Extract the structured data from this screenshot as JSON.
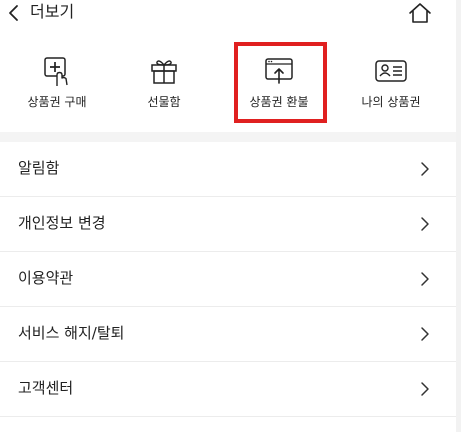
{
  "header": {
    "title": "더보기",
    "back_icon": "chevron-left-icon",
    "home_icon": "home-icon"
  },
  "quick_menu": {
    "items": [
      {
        "label": "상품권 구매",
        "icon": "purchase-voucher-icon"
      },
      {
        "label": "선물함",
        "icon": "gift-icon"
      },
      {
        "label": "상품권 환불",
        "icon": "refund-voucher-icon",
        "highlighted": true
      },
      {
        "label": "나의 상품권",
        "icon": "my-voucher-card-icon"
      }
    ],
    "highlight_color": "#e02020"
  },
  "menu": {
    "items": [
      {
        "label": "알림함"
      },
      {
        "label": "개인정보 변경"
      },
      {
        "label": "이용약관"
      },
      {
        "label": "서비스 해지/탈퇴"
      },
      {
        "label": "고객센터"
      }
    ],
    "chevron_icon": "chevron-right-icon"
  }
}
